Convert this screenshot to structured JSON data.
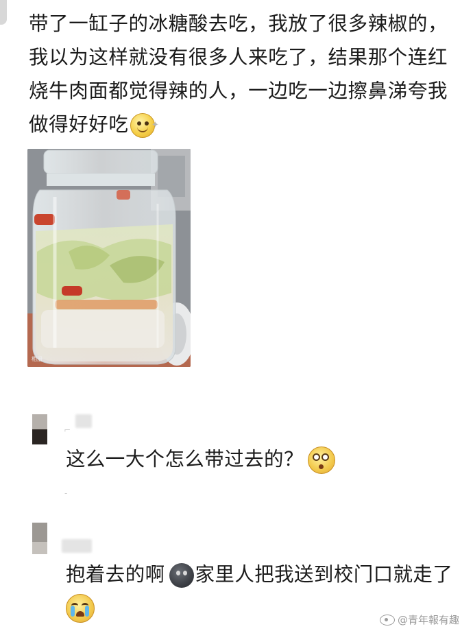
{
  "post": {
    "text": "带了一缸子的冰糖酸去吃，我放了很多辣椒的，我以为这样就没有很多人来吃了，结果那个连红烧牛肉面都觉得辣的人，一边吃一边擦鼻涕夸我做得好好吃",
    "photo_mark": "相册"
  },
  "comments": [
    {
      "text": "这么一大个怎么带过去的？"
    },
    {
      "text_before": "抱着去的啊",
      "text_after": "家里人把我送到校门口就走了"
    }
  ],
  "watermark": "@青年報有趣",
  "icons": {
    "post_emoji": "smile-emoji-icon",
    "comment1_emoji": "shocked-emoji-icon",
    "comment2_emoji_inline": "dark-face-emoji-icon",
    "comment2_emoji_end": "crying-emoji-icon",
    "watermark_logo": "weibo-logo-icon"
  },
  "colors": {
    "text": "#1b1b1b",
    "watermark": "#9a9a9a"
  }
}
